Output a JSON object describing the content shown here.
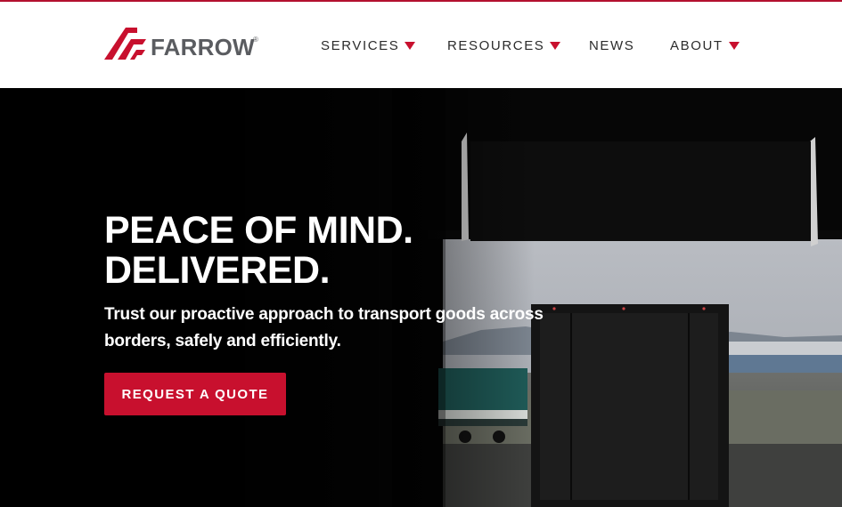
{
  "brand": {
    "name": "FARROW",
    "registered_mark": "®",
    "mark_icon": "farrow-chevron-logo",
    "colors": {
      "accent": "#c8102e",
      "wordmark": "#5a5c60",
      "header_bg": "#ffffff",
      "hero_bg": "#050505"
    }
  },
  "nav": {
    "items": [
      {
        "label": "SERVICES",
        "has_dropdown": true
      },
      {
        "label": "RESOURCES",
        "has_dropdown": true
      },
      {
        "label": "NEWS",
        "has_dropdown": false
      },
      {
        "label": "ABOUT",
        "has_dropdown": true
      }
    ],
    "dropdown_icon": "caret-down-icon"
  },
  "hero": {
    "headline_line1": "PEACE OF MIND.",
    "headline_line2": "DELIVERED.",
    "subtext": "Trust our proactive approach to transport goods across borders, safely and efficiently.",
    "cta_label": "REQUEST A QUOTE",
    "background_image": "loading-dock-with-trailer"
  }
}
